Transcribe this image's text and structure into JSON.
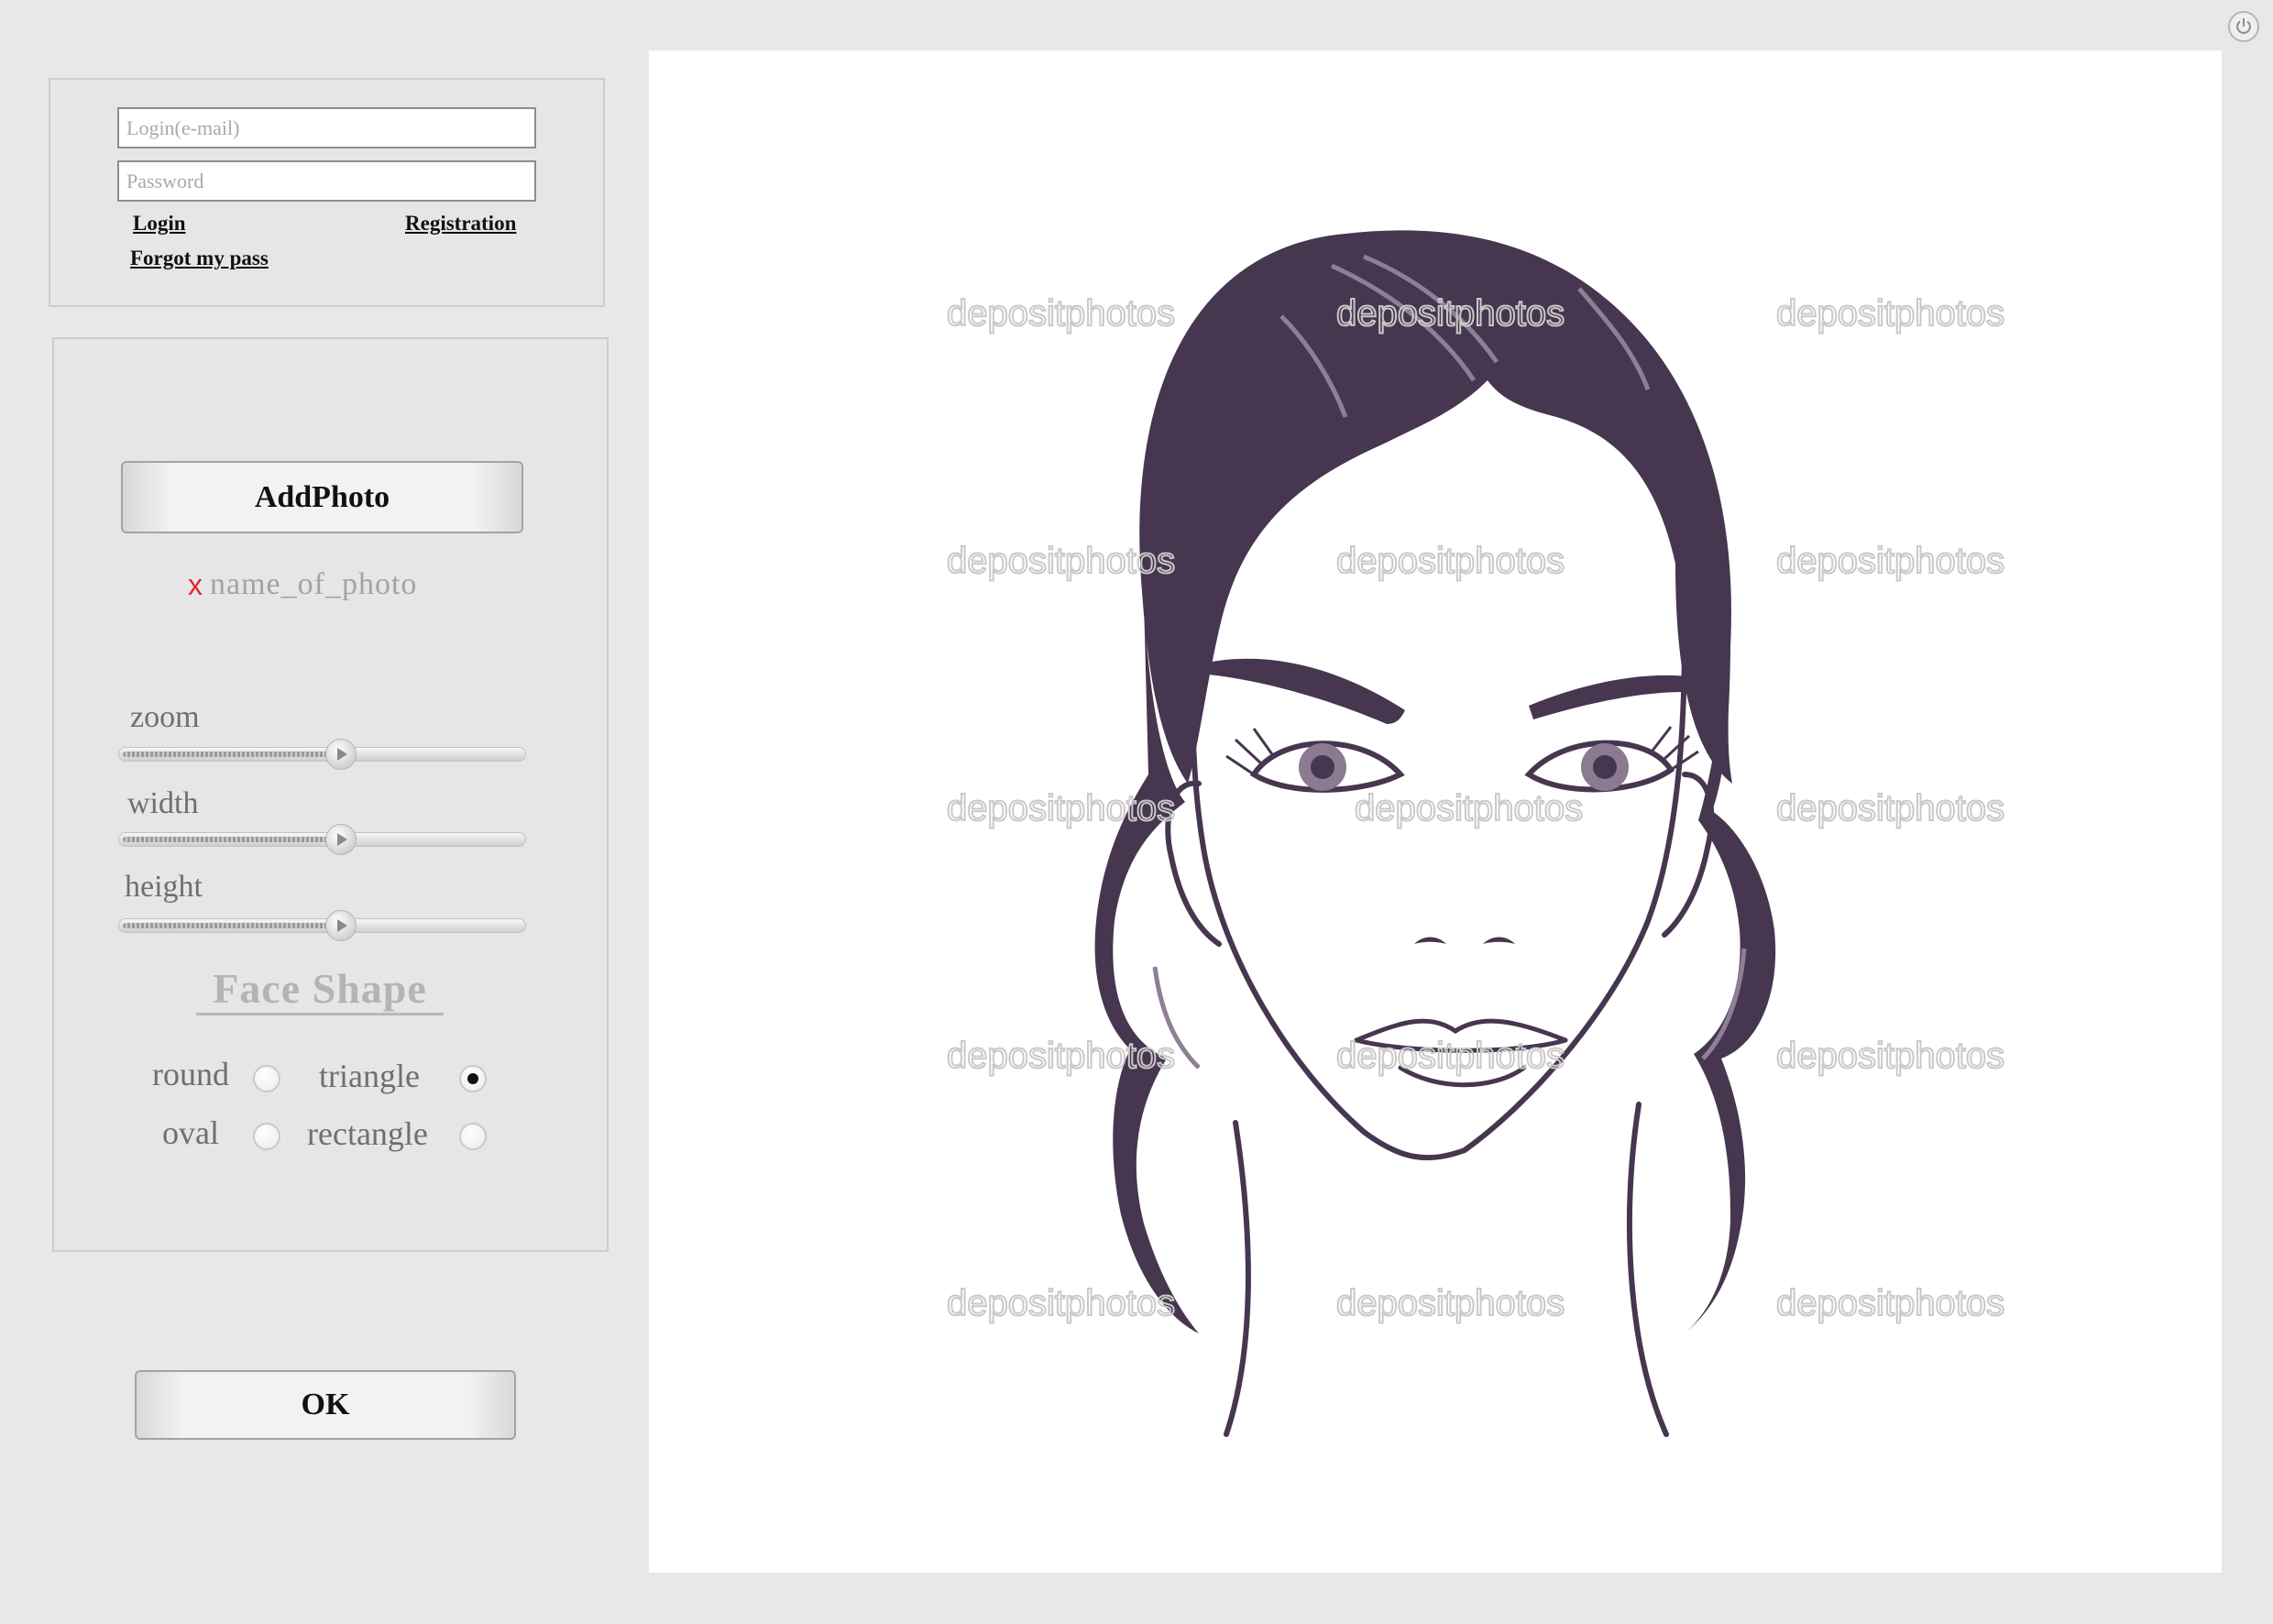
{
  "login": {
    "email_placeholder": "Login(e-mail)",
    "password_placeholder": "Password",
    "login_link": "Login",
    "registration_link": "Registration",
    "forgot_link": "Forgot my pass"
  },
  "photo": {
    "add_button": "AddPhoto",
    "remove_icon": "x",
    "file_name": "name_of_photo"
  },
  "sliders": [
    {
      "label": "zoom",
      "value_percent": 57
    },
    {
      "label": "width",
      "value_percent": 57
    },
    {
      "label": "height",
      "value_percent": 57
    }
  ],
  "face_shape": {
    "title": "Face Shape",
    "options": [
      {
        "label": "round",
        "checked": false
      },
      {
        "label": "triangle",
        "checked": true
      },
      {
        "label": "oval",
        "checked": false
      },
      {
        "label": "rectangle",
        "checked": false
      }
    ]
  },
  "ok_button": "OK",
  "canvas": {
    "watermark": "depositphotos",
    "image": "female-face-line-illustration",
    "hair_color": "#47364f"
  },
  "icons": {
    "power": "power-icon"
  }
}
